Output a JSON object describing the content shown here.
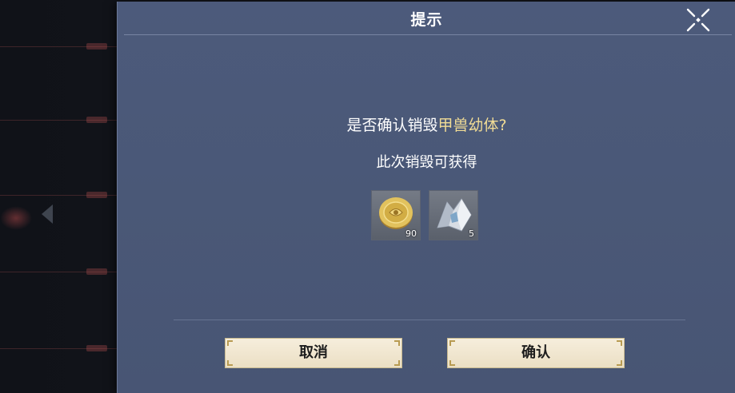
{
  "dialog": {
    "title": "提示",
    "question_prefix": "是否确认销毁",
    "question_item": "甲兽幼体",
    "question_suffix": "?",
    "subtitle": "此次销毁可获得",
    "rewards": [
      {
        "icon": "gold-coin-icon",
        "count": "90"
      },
      {
        "icon": "silver-crystal-icon",
        "count": "5"
      }
    ],
    "cancel_label": "取消",
    "confirm_label": "确认",
    "close_icon": "close-x-icon"
  },
  "colors": {
    "panel": "#4a5877",
    "highlight": "#f1dc95",
    "button": "#f6eedc"
  }
}
